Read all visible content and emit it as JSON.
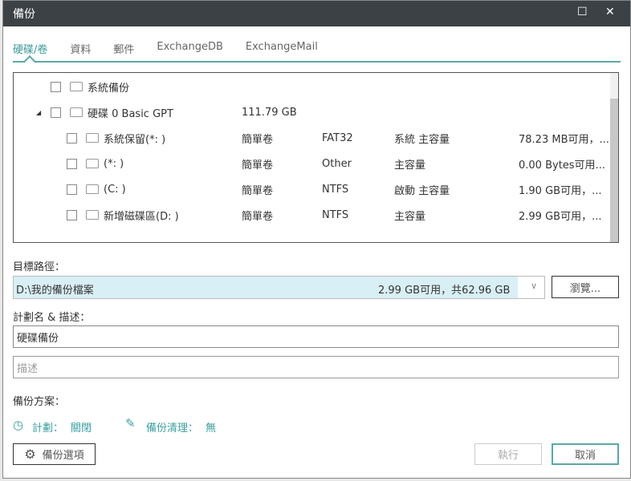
{
  "window": {
    "title": "備份",
    "maximize_icon": "square-icon",
    "close_icon": "close-icon"
  },
  "tabs": [
    {
      "label": "硬碟/卷",
      "active": true
    },
    {
      "label": "資料"
    },
    {
      "label": "郵件"
    },
    {
      "label": "ExchangeDB"
    },
    {
      "label": "ExchangeMail"
    }
  ],
  "tree": {
    "system_backup": "系統備份",
    "disk": {
      "name": "硬碟 0 Basic GPT",
      "size": "111.79 GB"
    },
    "partitions": [
      {
        "name": "系統保留(*: )",
        "type": "簡單卷",
        "fs": "FAT32",
        "role": "系統 主容量",
        "space": "78.23 MB可用，..."
      },
      {
        "name": "(*: )",
        "type": "簡單卷",
        "fs": "Other",
        "role": "主容量",
        "space": "0.00 Bytes可用..."
      },
      {
        "name": "(C: )",
        "type": "簡單卷",
        "fs": "NTFS",
        "role": "啟動 主容量",
        "space": "1.90 GB可用，..."
      },
      {
        "name": "新增磁碟區(D: )",
        "type": "簡單卷",
        "fs": "NTFS",
        "role": "主容量",
        "space": "2.99 GB可用，..."
      }
    ]
  },
  "target": {
    "label": "目標路徑：",
    "path": "D:\\我的備份檔案",
    "space": "2.99 GB可用，共62.96 GB",
    "used_fraction": 0.95,
    "browse": "瀏覽..."
  },
  "plan": {
    "label": "計劃名 & 描述：",
    "name": "硬碟備份",
    "desc_placeholder": "描述"
  },
  "scheme": {
    "label": "備份方案：",
    "schedule_label": "計劃：",
    "schedule_value": "關閉",
    "cleanup_label": "備份清理：",
    "cleanup_value": "無"
  },
  "footer": {
    "options": "備份選項",
    "run": "執行",
    "cancel": "取消"
  },
  "colors": {
    "accent": "#3aa0a0",
    "titlebar": "#3c4146"
  }
}
